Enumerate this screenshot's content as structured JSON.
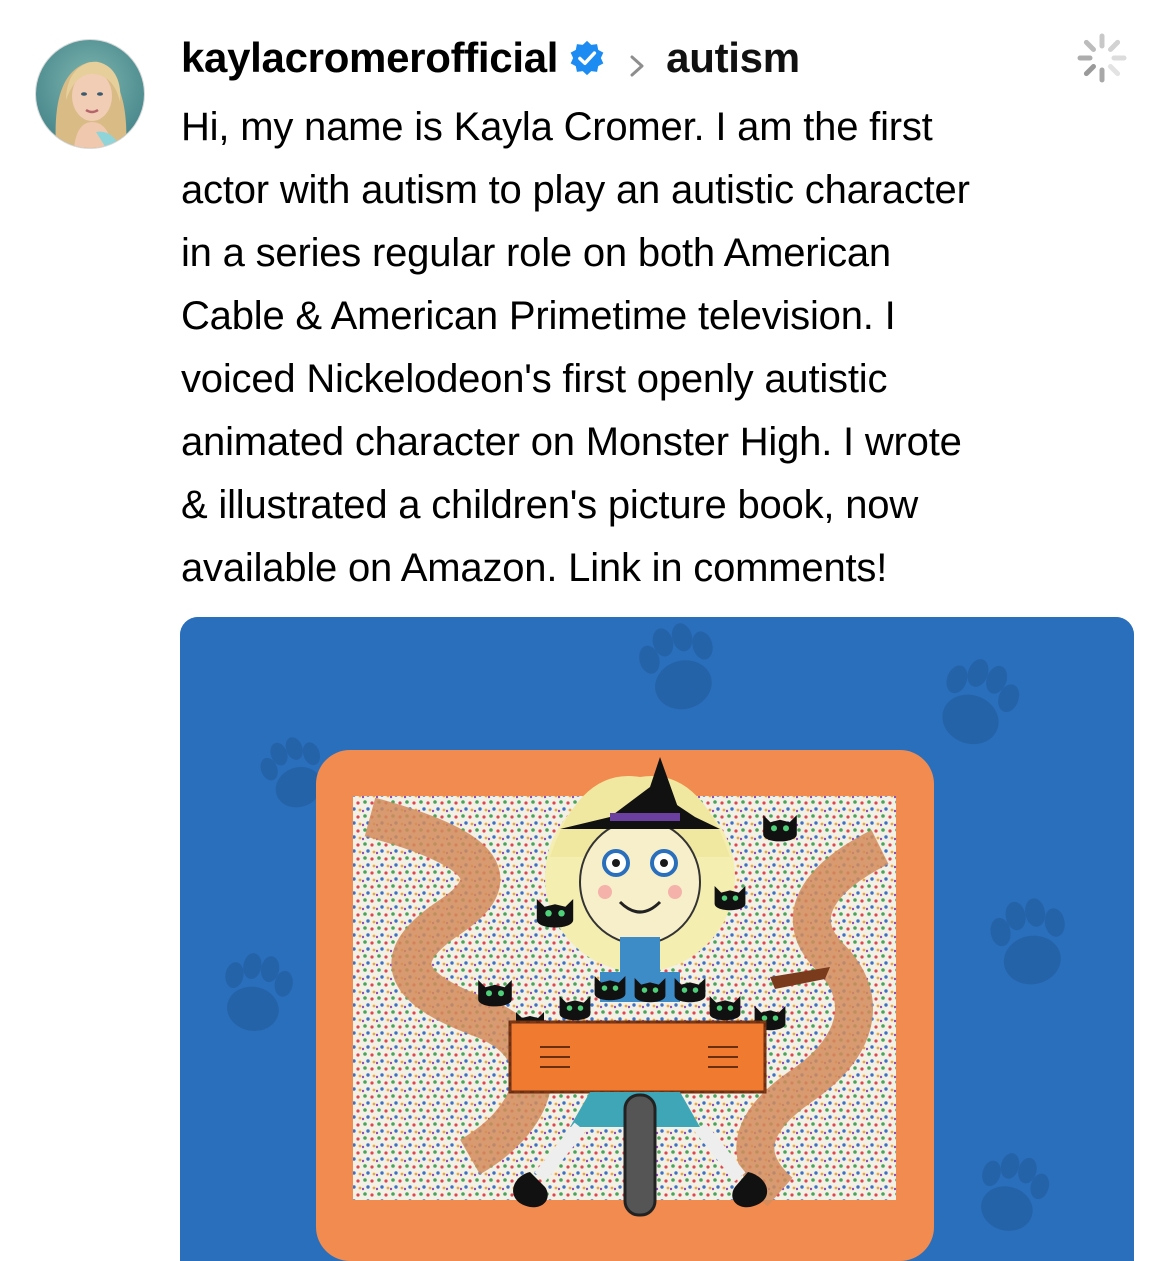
{
  "post": {
    "username": "kaylacromerofficial",
    "community": "autism",
    "body": "Hi, my name is Kayla Cromer. I am the first\nactor with autism to play an autistic character\nin a series regular role on both American\nCable & American Primetime television. I\nvoiced Nickelodeon's first openly autistic\nanimated character on Monster High. I wrote\n& illustrated a children's picture book, now\navailable on Amazon. Link in comments!"
  },
  "icons": {
    "avatar": "profile-photo",
    "verified": "verified-badge-icon",
    "chevron": "chevron-right-icon",
    "loading": "loading-spinner-icon"
  },
  "colors": {
    "verified_blue": "#1d8cf2",
    "media_background": "#2a6fbc",
    "paw_print": "#2563a9",
    "frame_orange": "#f28b4f"
  }
}
